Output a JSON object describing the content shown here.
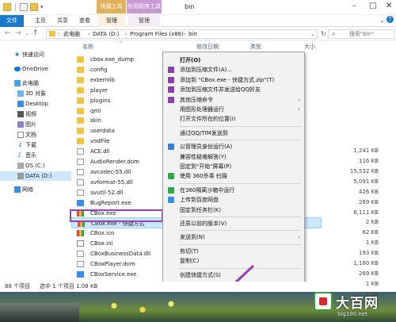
{
  "window": {
    "title": "bin",
    "context_group_1": "快捷工具",
    "context_group_2": "应用程序工具"
  },
  "ribbon": {
    "tabs": [
      "文件",
      "主页",
      "共享",
      "查看",
      "管理",
      "管理"
    ]
  },
  "address": {
    "crumbs": [
      "此电脑",
      "DATA (D:)",
      "Program Files (x86)",
      "bin"
    ],
    "search_placeholder": "搜索\"bin\""
  },
  "sidebar": {
    "items": [
      {
        "label": "快速访问",
        "icon": "star-icon"
      },
      {
        "label": "OneDrive",
        "icon": "cloud-icon"
      },
      {
        "label": "此电脑",
        "icon": "computer-icon"
      },
      {
        "label": "3D 对象",
        "icon": "cube-icon"
      },
      {
        "label": "Desktop",
        "icon": "desktop-icon"
      },
      {
        "label": "视频",
        "icon": "video-icon"
      },
      {
        "label": "图片",
        "icon": "picture-icon"
      },
      {
        "label": "文档",
        "icon": "document-icon"
      },
      {
        "label": "下载",
        "icon": "download-icon"
      },
      {
        "label": "音乐",
        "icon": "music-icon"
      },
      {
        "label": "OS (C:)",
        "icon": "drive-icon"
      },
      {
        "label": "DATA (D:)",
        "icon": "drive-icon"
      },
      {
        "label": "网络",
        "icon": "network-icon"
      }
    ]
  },
  "columns": {
    "name": "名称",
    "date": "修改日期",
    "type": "类型",
    "size": "大小"
  },
  "files": [
    {
      "name": "cbox.exe_dump",
      "kind": "folder"
    },
    {
      "name": "config",
      "kind": "folder"
    },
    {
      "name": "externlib",
      "kind": "folder"
    },
    {
      "name": "player",
      "kind": "folder"
    },
    {
      "name": "plugins",
      "kind": "folder"
    },
    {
      "name": "qml",
      "kind": "folder"
    },
    {
      "name": "skin",
      "kind": "folder"
    },
    {
      "name": "userdata",
      "kind": "folder"
    },
    {
      "name": "vodFile",
      "kind": "folder"
    },
    {
      "name": "ACE.dll",
      "kind": "dll",
      "size": "1,241 KB"
    },
    {
      "name": "AudioRender.dom",
      "kind": "dll",
      "size": "116 KB"
    },
    {
      "name": "avcodec-55.dll",
      "kind": "dll",
      "size": "15,532 KB"
    },
    {
      "name": "avformat-55.dll",
      "kind": "dll",
      "size": "5,091 KB"
    },
    {
      "name": "avutil-52.dll",
      "kind": "dll",
      "size": "426 KB"
    },
    {
      "name": "BugReport.exe",
      "kind": "exe",
      "size": "269 KB"
    },
    {
      "name": "CBox.exe",
      "kind": "cbox",
      "size": "8,111 KB"
    },
    {
      "name": "CBox.exe - 快捷方式",
      "kind": "cbox",
      "size": "2 KB"
    },
    {
      "name": "CBox.ico",
      "kind": "cbox",
      "size": "62 KB"
    },
    {
      "name": "CBox.ini",
      "kind": "dat",
      "size": "1 KB"
    },
    {
      "name": "CBoxBusinessData.dll",
      "kind": "dll",
      "size": "193 KB"
    },
    {
      "name": "CBoxPlayer.dom",
      "kind": "dll",
      "size": "1,180 KB"
    },
    {
      "name": "CBoxService.exe",
      "kind": "exe",
      "size": "269 KB"
    },
    {
      "name": "channel.dat",
      "kind": "dat",
      "size": "1 KB"
    },
    {
      "name": "",
      "kind": "xml",
      "size": "1 KB"
    }
  ],
  "context_menu": {
    "items": [
      {
        "label": "打开(O)",
        "bold": true,
        "icon": ""
      },
      {
        "label": "添加到压缩文件(A)...",
        "icon": "winrar-icon"
      },
      {
        "label": "添加到 \"CBox.exe - 快捷方式.zip\"(T)",
        "icon": "winrar-icon"
      },
      {
        "label": "添加到压缩文件并发送给QQ好友",
        "icon": "winrar-icon"
      },
      {
        "label": "其他压缩命令",
        "icon": "winrar-icon",
        "sub": "›"
      },
      {
        "label": "用图形处理器运行",
        "icon": "",
        "sub": "›"
      },
      {
        "label": "打开文件所在的位置(I)",
        "icon": ""
      },
      {
        "sep": true
      },
      {
        "label": "通过QQ/TIM发送到",
        "icon": ""
      },
      {
        "sep": true
      },
      {
        "label": "以管理员身份运行(A)",
        "icon": "shield-icon"
      },
      {
        "label": "兼容性疑难解答(Y)",
        "icon": ""
      },
      {
        "label": "固定到\"开始\"屏幕(P)",
        "icon": ""
      },
      {
        "label": "使用 360杀毒 扫描",
        "icon": "antivirus-icon"
      },
      {
        "sep": true
      },
      {
        "label": "在360隔离沙箱中运行",
        "icon": "sandbox-icon"
      },
      {
        "label": "上传到百度网盘",
        "icon": "cloud-upload-icon"
      },
      {
        "label": "固定到任务栏(K)",
        "icon": ""
      },
      {
        "sep": true
      },
      {
        "label": "还原以前的版本(V)",
        "icon": ""
      },
      {
        "sep": true
      },
      {
        "label": "发送到(N)",
        "icon": "",
        "sub": "›"
      },
      {
        "sep": true
      },
      {
        "label": "剪切(T)",
        "icon": ""
      },
      {
        "label": "复制(C)",
        "icon": ""
      },
      {
        "sep": true
      },
      {
        "label": "创建快捷方式(S)",
        "icon": ""
      },
      {
        "label": "删除(D)",
        "icon": ""
      },
      {
        "label": "重命名(M)",
        "icon": ""
      },
      {
        "sep": true
      },
      {
        "label": "属性(R)",
        "icon": ""
      }
    ]
  },
  "status": {
    "count": "88 个项目",
    "selected": "选中 1 个项目  1.08 KB"
  },
  "watermark": {
    "text": "大百网",
    "url": "big100.net"
  },
  "colors": {
    "accent": "#1979ca",
    "highlight_box": "#9a3fb3",
    "selection": "#cce8ff"
  }
}
